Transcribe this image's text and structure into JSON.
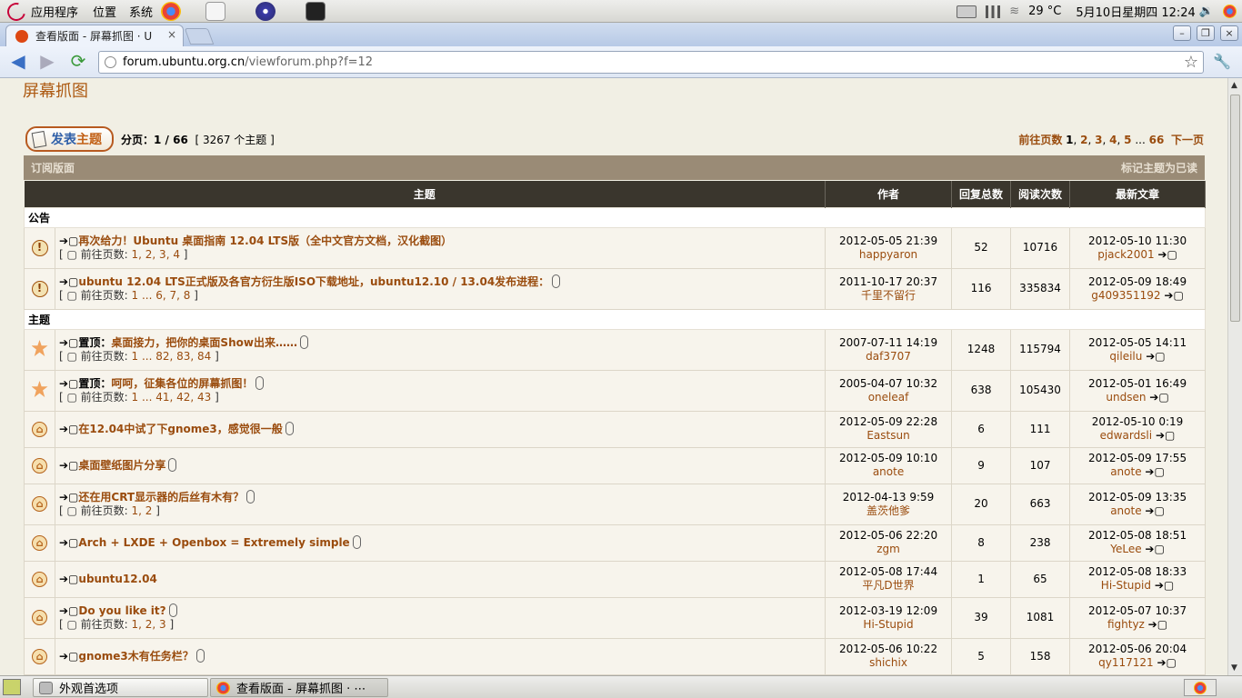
{
  "topbar": {
    "apps": "应用程序",
    "places": "位置",
    "system": "系统",
    "temperature": "29 °C",
    "datetime": "5月10日星期四  12:24"
  },
  "browser": {
    "tab_title": "查看版面 - 屏幕抓图 · U",
    "url_host": "forum.ubuntu.org.cn",
    "url_path": "/viewforum.php?f=12"
  },
  "forum": {
    "title": "屏幕抓图",
    "post_button_a": "发表",
    "post_button_b": "主题",
    "page_label": "分页：",
    "page_value": "1 / 66",
    "topic_count": "[ 3267 个主题 ]",
    "goto_label": "前往页数",
    "pages": [
      "1",
      "2",
      "3",
      "4",
      "5",
      "...",
      "66"
    ],
    "next": "下一页",
    "subscribe": "订阅版面",
    "mark_read": "标记主题为已读"
  },
  "columns": {
    "topic": "主题",
    "author": "作者",
    "replies": "回复总数",
    "views": "阅读次数",
    "last": "最新文章"
  },
  "sections": {
    "announce": "公告",
    "topics": "主题"
  },
  "pages_label": "前往页数:",
  "announcements": [
    {
      "icon": "info",
      "title": "再次给力！Ubuntu 桌面指南 12.04 LTS版（全中文官方文档，汉化截图）",
      "pages": "1, 2, 3, 4",
      "clip": false,
      "time": "2012-05-05 21:39",
      "author": "happyaron",
      "replies": "52",
      "views": "10716",
      "last_time": "2012-05-10 11:30",
      "last_author": "pjack2001"
    },
    {
      "icon": "info",
      "title": "ubuntu 12.04 LTS正式版及各官方衍生版ISO下载地址，ubuntu12.10 / 13.04发布进程：",
      "pages": "1 ... 6, 7, 8",
      "clip": true,
      "time": "2011-10-17 20:37",
      "author": "千里不留行",
      "replies": "116",
      "views": "335834",
      "last_time": "2012-05-09 18:49",
      "last_author": "g409351192"
    }
  ],
  "topics": [
    {
      "icon": "sticky",
      "prefix": "置顶：",
      "title": "桌面接力，把你的桌面Show出来……",
      "pages": "1 ... 82, 83, 84",
      "clip": true,
      "time": "2007-07-11 14:19",
      "author": "daf3707",
      "replies": "1248",
      "views": "115794",
      "last_time": "2012-05-05 14:11",
      "last_author": "qileilu"
    },
    {
      "icon": "sticky",
      "prefix": "置顶：",
      "title": "呵呵，征集各位的屏幕抓图！",
      "pages": "1 ... 41, 42, 43",
      "clip": true,
      "time": "2005-04-07 10:32",
      "author": "oneleaf",
      "replies": "638",
      "views": "105430",
      "last_time": "2012-05-01 16:49",
      "last_author": "undsen"
    },
    {
      "icon": "normal",
      "prefix": "",
      "title": "在12.04中试了下gnome3，感觉很一般",
      "pages": "",
      "clip": true,
      "time": "2012-05-09 22:28",
      "author": "Eastsun",
      "replies": "6",
      "views": "111",
      "last_time": "2012-05-10 0:19",
      "last_author": "edwardsli"
    },
    {
      "icon": "normal",
      "prefix": "",
      "title": "桌面壁纸图片分享",
      "pages": "",
      "clip": true,
      "time": "2012-05-09 10:10",
      "author": "anote",
      "replies": "9",
      "views": "107",
      "last_time": "2012-05-09 17:55",
      "last_author": "anote"
    },
    {
      "icon": "normal",
      "prefix": "",
      "title": "还在用CRT显示器的后丝有木有？",
      "pages": "1, 2",
      "clip": true,
      "time": "2012-04-13 9:59",
      "author": "盖茨他爹",
      "replies": "20",
      "views": "663",
      "last_time": "2012-05-09 13:35",
      "last_author": "anote"
    },
    {
      "icon": "normal",
      "prefix": "",
      "title": "Arch + LXDE + Openbox = Extremely simple",
      "pages": "",
      "clip": true,
      "time": "2012-05-06 22:20",
      "author": "zgm",
      "replies": "8",
      "views": "238",
      "last_time": "2012-05-08 18:51",
      "last_author": "YeLee"
    },
    {
      "icon": "normal",
      "prefix": "",
      "title": "ubuntu12.04",
      "pages": "",
      "clip": false,
      "time": "2012-05-08 17:44",
      "author": "平凡D世界",
      "replies": "1",
      "views": "65",
      "last_time": "2012-05-08 18:33",
      "last_author": "Hi-Stupid"
    },
    {
      "icon": "normal",
      "prefix": "",
      "title": "Do you like it?",
      "pages": "1, 2, 3",
      "clip": true,
      "time": "2012-03-19 12:09",
      "author": "Hi-Stupid",
      "replies": "39",
      "views": "1081",
      "last_time": "2012-05-07 10:37",
      "last_author": "fightyz"
    },
    {
      "icon": "normal",
      "prefix": "",
      "title": "gnome3木有任务栏？",
      "pages": "",
      "clip": true,
      "time": "2012-05-06 10:22",
      "author": "shichix",
      "replies": "5",
      "views": "158",
      "last_time": "2012-05-06 20:04",
      "last_author": "qy117121"
    }
  ],
  "taskbar": {
    "item1": "外观首选项",
    "item2": "查看版面 - 屏幕抓图 · ⋯"
  }
}
